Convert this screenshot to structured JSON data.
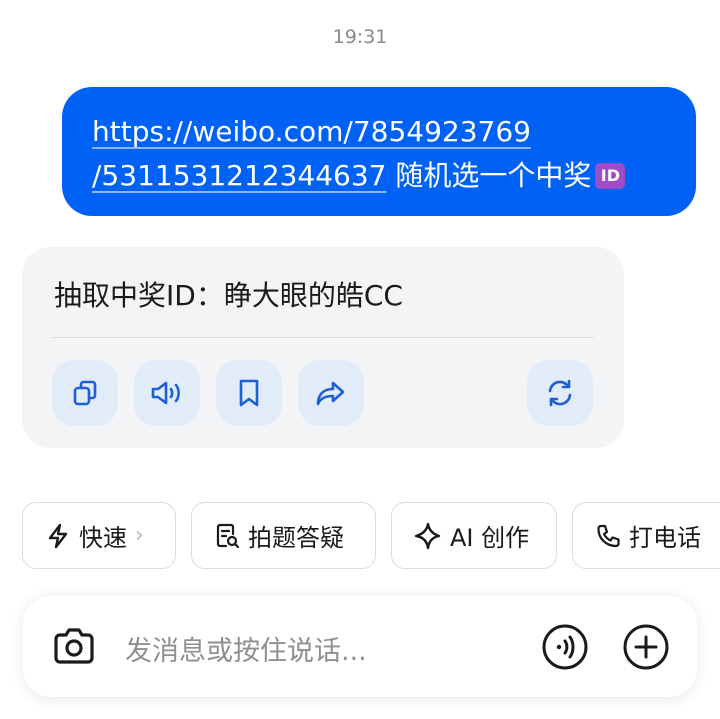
{
  "status": {
    "time": "19:31"
  },
  "user_message": {
    "line1": "https://weibo.com/7854923769",
    "line2_link": "/5311531212344637",
    "line2_text": " 随机选一个中奖",
    "badge": "ID"
  },
  "reply": {
    "text": "抽取中奖ID：睁大眼的皓CC",
    "actions": [
      "copy-icon",
      "speaker-icon",
      "bookmark-icon",
      "share-icon",
      "regenerate-icon"
    ]
  },
  "quick_actions": [
    {
      "label": "快速",
      "icon": "lightning-icon",
      "chevron": "›"
    },
    {
      "label": "拍题答疑",
      "icon": "photo-search-icon"
    },
    {
      "label": "AI 创作",
      "icon": "sparkle-icon"
    },
    {
      "label": "打电话",
      "icon": "phone-icon"
    }
  ],
  "input": {
    "placeholder": "发消息或按住说话...",
    "icons": [
      "camera-icon",
      "voice-wave-icon",
      "plus-icon"
    ]
  },
  "colors": {
    "user_bubble": "#0062f5",
    "reply_bg": "#f3f4f6",
    "action_btn_bg": "#e2ebf8",
    "icon_blue": "#1f5fd6"
  }
}
